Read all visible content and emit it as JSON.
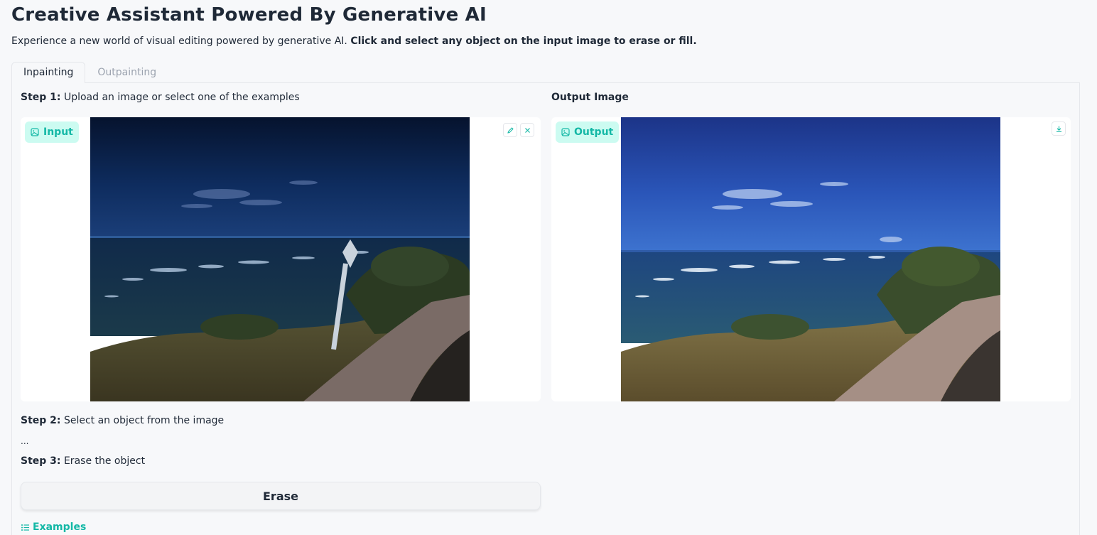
{
  "header": {
    "title": "Creative Assistant Powered By Generative AI",
    "subtitle_plain": "Experience a new world of visual editing powered by generative AI. ",
    "subtitle_bold": "Click and select any object on the input image to erase or fill."
  },
  "tabs": [
    {
      "label": "Inpainting",
      "active": true
    },
    {
      "label": "Outpainting",
      "active": false
    }
  ],
  "steps": {
    "step1_bold": "Step 1:",
    "step1_text": " Upload an image or select one of the examples",
    "step2_bold": "Step 2:",
    "step2_text": " Select an object from the image",
    "step2_status": "...",
    "step3_bold": "Step 3:",
    "step3_text": " Erase the object"
  },
  "input_image": {
    "badge": "Input",
    "icons": [
      "edit-icon",
      "close-icon"
    ]
  },
  "output_image": {
    "heading": "Output Image",
    "badge": "Output",
    "icons": [
      "download-icon"
    ]
  },
  "actions": {
    "erase_label": "Erase"
  },
  "examples": {
    "label": "Examples"
  },
  "colors": {
    "accent": "#14b8a6",
    "badge_bg": "#ccfbf1",
    "page_bg": "#f7f8fa"
  }
}
